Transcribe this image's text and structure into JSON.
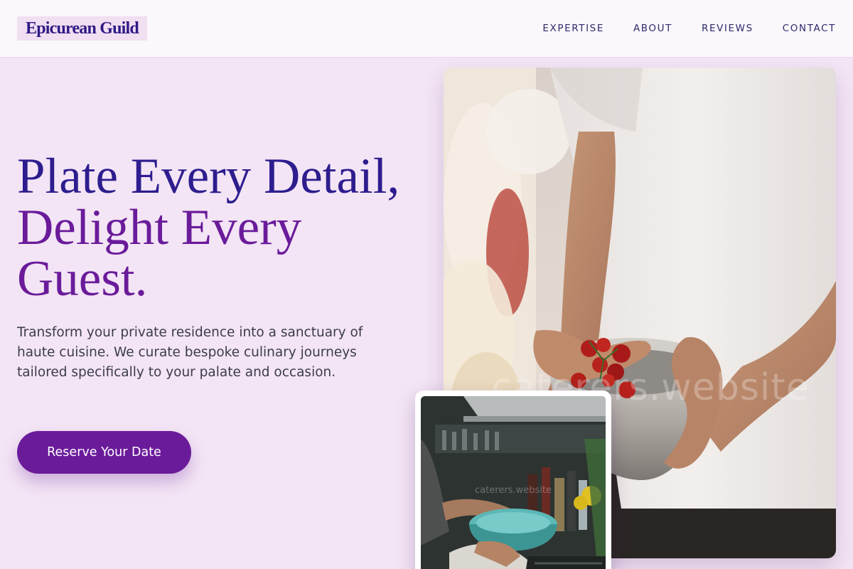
{
  "brand": {
    "name": "Epicurean Guild"
  },
  "nav": {
    "items": [
      {
        "label": "EXPERTISE"
      },
      {
        "label": "ABOUT"
      },
      {
        "label": "REVIEWS"
      },
      {
        "label": "CONTACT"
      }
    ]
  },
  "hero": {
    "headline_line1": "Plate Every Detail,",
    "headline_line2": "Delight Every Guest.",
    "lead": "Transform your private residence into a sanctuary of haute cuisine. We curate bespoke culinary journeys tailored specifically to your palate and occasion.",
    "cta_label": "Reserve Your Date"
  },
  "images": {
    "main_watermark": "caterers.website",
    "sub_watermark": "caterers.website"
  },
  "colors": {
    "page_bg": "#f3e5f5",
    "brand_indigo": "#2d1d8e",
    "accent_purple": "#6a1b9a",
    "button_text": "#ffffff"
  }
}
